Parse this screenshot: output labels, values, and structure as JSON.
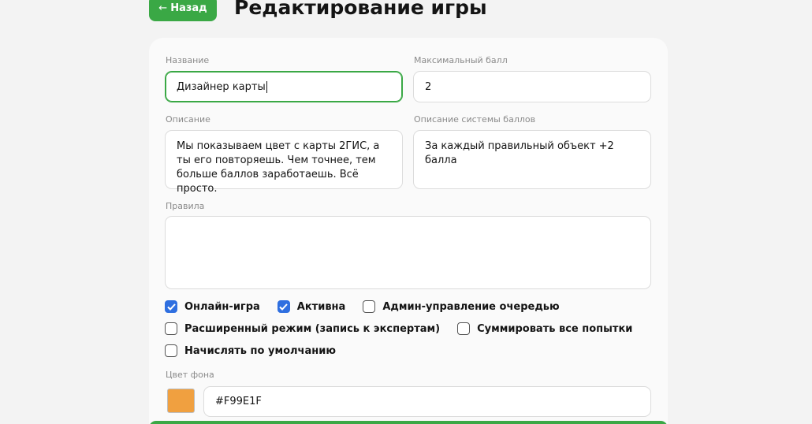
{
  "header": {
    "back_label": "Назад",
    "back_arrow": "←",
    "title": "Редактирование игры"
  },
  "form": {
    "name": {
      "label": "Название",
      "value": "Дизайнер карты"
    },
    "max_score": {
      "label": "Максимальный балл",
      "value": "2"
    },
    "description": {
      "label": "Описание",
      "value": "Мы показываем цвет с карты 2ГИС, а ты его повторяешь. Чем точнее, тем больше баллов заработаешь. Всё просто."
    },
    "score_description": {
      "label": "Описание системы баллов",
      "value": "За каждый правильный объект +2 балла"
    },
    "rules": {
      "label": "Правила",
      "value": ""
    },
    "checkboxes": [
      {
        "label": "Онлайн-игра",
        "checked": true
      },
      {
        "label": "Активна",
        "checked": true
      },
      {
        "label": "Админ-управление очередью",
        "checked": false
      },
      {
        "label": "Расширенный режим (запись к экспертам)",
        "checked": false
      },
      {
        "label": "Суммировать все попытки",
        "checked": false
      },
      {
        "label": "Начислять по умолчанию",
        "checked": false
      }
    ],
    "bg_color": {
      "label": "Цвет фона",
      "value": "#F99E1F"
    }
  },
  "colors": {
    "accent": "#3aa845",
    "checkbox_checked": "#2f6fe0",
    "swatch": "#f0a040"
  },
  "icons": {
    "checkmark": "checkmark-icon",
    "back": "arrow-left-icon"
  }
}
